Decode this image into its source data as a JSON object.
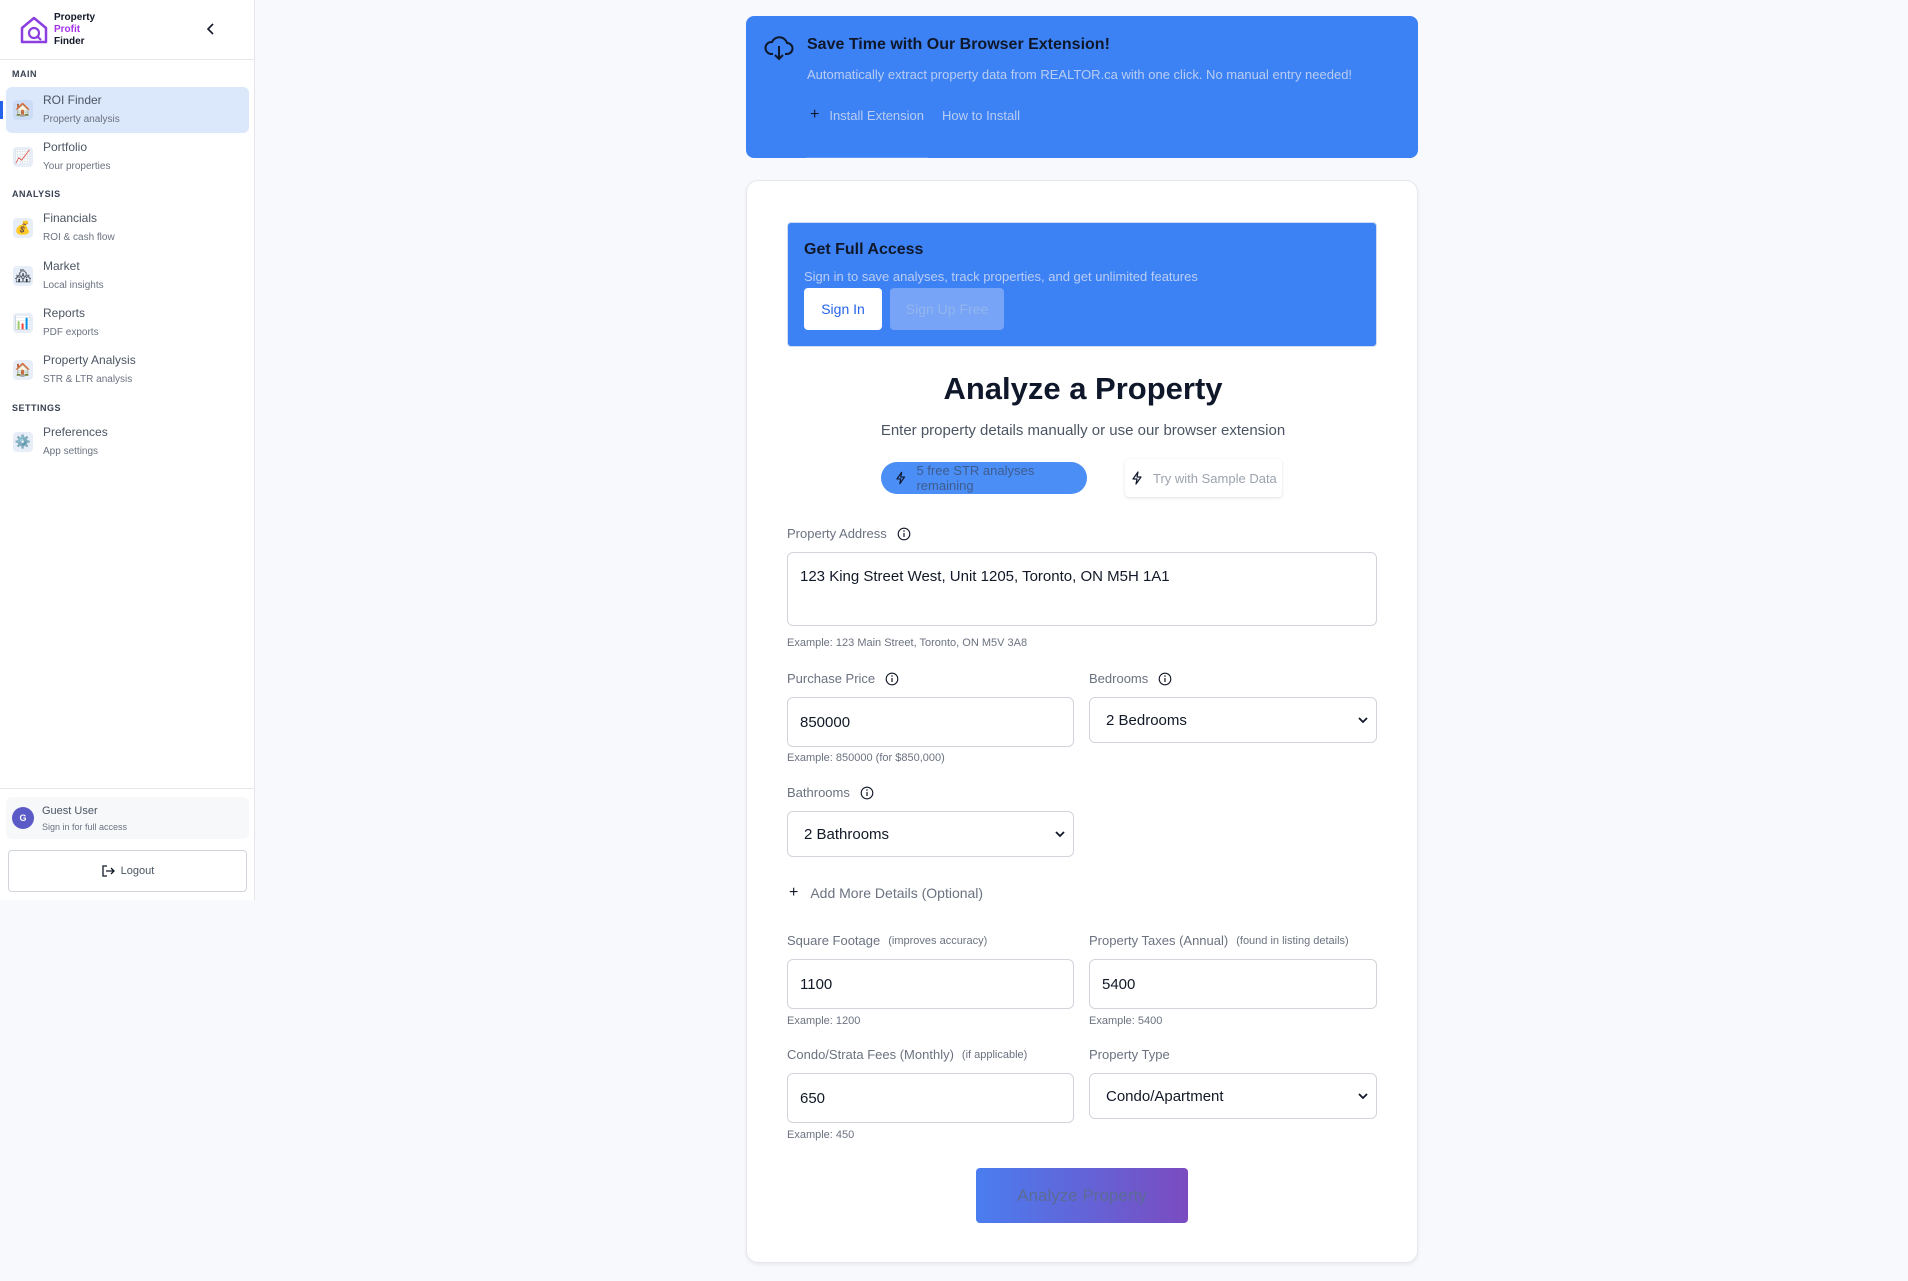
{
  "app": {
    "logo_line1": "Property",
    "logo_line2": "Profit",
    "logo_line3": "Finder"
  },
  "sidebar": {
    "sections": {
      "main": "MAIN",
      "analysis": "ANALYSIS",
      "settings": "SETTINGS"
    },
    "items": [
      {
        "label": "ROI Finder",
        "sub": "Property analysis",
        "icon": "house-icon",
        "active": true
      },
      {
        "label": "Portfolio",
        "sub": "Your properties",
        "icon": "chart-up-icon"
      },
      {
        "label": "Financials",
        "sub": "ROI & cash flow",
        "icon": "money-bag-icon"
      },
      {
        "label": "Market",
        "sub": "Local insights",
        "icon": "houses-icon"
      },
      {
        "label": "Reports",
        "sub": "PDF exports",
        "icon": "bar-chart-icon"
      },
      {
        "label": "Property Analysis",
        "sub": "STR & LTR analysis",
        "icon": "house-icon"
      },
      {
        "label": "Preferences",
        "sub": "App settings",
        "icon": "gear-icon"
      }
    ],
    "user": {
      "avatar": "G",
      "name": "Guest User",
      "sub": "Sign in for full access"
    },
    "logout": "Logout"
  },
  "extension_banner": {
    "title": "Save Time with Our Browser Extension!",
    "description": "Automatically extract property data from REALTOR.ca with one click. No manual entry needed!",
    "install": "Install Extension",
    "howto": "How to Install"
  },
  "access": {
    "title": "Get Full Access",
    "description": "Sign in to save analyses, track properties, and get unlimited features",
    "sign_in": "Sign In",
    "sign_up": "Sign Up Free"
  },
  "form": {
    "title": "Analyze a Property",
    "subtitle": "Enter property details manually or use our browser extension",
    "free_pill": "5 free STR analyses remaining",
    "sample_button": "Try with Sample Data",
    "address": {
      "label": "Property Address",
      "value": "123 King Street West, Unit 1205, Toronto, ON M5H 1A1",
      "example": "Example: 123 Main Street, Toronto, ON M5V 3A8"
    },
    "price": {
      "label": "Purchase Price",
      "value": "850000",
      "example": "Example: 850000 (for $850,000)"
    },
    "bedrooms": {
      "label": "Bedrooms",
      "value": "2 Bedrooms"
    },
    "bathrooms": {
      "label": "Bathrooms",
      "value": "2 Bathrooms"
    },
    "add_more": "Add More Details (Optional)",
    "sqft": {
      "label": "Square Footage",
      "hint": "(improves accuracy)",
      "value": "1100",
      "example": "Example: 1200"
    },
    "taxes": {
      "label": "Property Taxes (Annual)",
      "hint": "(found in listing details)",
      "value": "5400",
      "example": "Example: 5400"
    },
    "condo": {
      "label": "Condo/Strata Fees (Monthly)",
      "hint": "(if applicable)",
      "value": "650",
      "example": "Example: 450"
    },
    "type": {
      "label": "Property Type",
      "value": "Condo/Apartment"
    },
    "submit": "Analyze Property"
  },
  "colors": {
    "accent": "#3d82f4",
    "brand_purple": "#a333e8",
    "active_nav": "#dbe7fb"
  }
}
